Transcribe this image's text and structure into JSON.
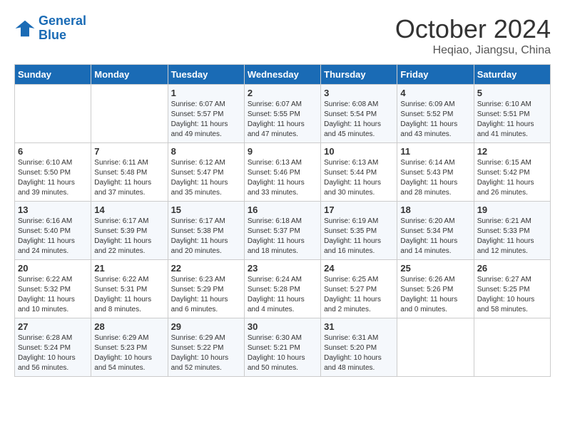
{
  "logo": {
    "line1": "General",
    "line2": "Blue"
  },
  "title": "October 2024",
  "subtitle": "Heqiao, Jiangsu, China",
  "weekdays": [
    "Sunday",
    "Monday",
    "Tuesday",
    "Wednesday",
    "Thursday",
    "Friday",
    "Saturday"
  ],
  "weeks": [
    [
      {
        "day": "",
        "info": ""
      },
      {
        "day": "",
        "info": ""
      },
      {
        "day": "1",
        "info": "Sunrise: 6:07 AM\nSunset: 5:57 PM\nDaylight: 11 hours and 49 minutes."
      },
      {
        "day": "2",
        "info": "Sunrise: 6:07 AM\nSunset: 5:55 PM\nDaylight: 11 hours and 47 minutes."
      },
      {
        "day": "3",
        "info": "Sunrise: 6:08 AM\nSunset: 5:54 PM\nDaylight: 11 hours and 45 minutes."
      },
      {
        "day": "4",
        "info": "Sunrise: 6:09 AM\nSunset: 5:52 PM\nDaylight: 11 hours and 43 minutes."
      },
      {
        "day": "5",
        "info": "Sunrise: 6:10 AM\nSunset: 5:51 PM\nDaylight: 11 hours and 41 minutes."
      }
    ],
    [
      {
        "day": "6",
        "info": "Sunrise: 6:10 AM\nSunset: 5:50 PM\nDaylight: 11 hours and 39 minutes."
      },
      {
        "day": "7",
        "info": "Sunrise: 6:11 AM\nSunset: 5:48 PM\nDaylight: 11 hours and 37 minutes."
      },
      {
        "day": "8",
        "info": "Sunrise: 6:12 AM\nSunset: 5:47 PM\nDaylight: 11 hours and 35 minutes."
      },
      {
        "day": "9",
        "info": "Sunrise: 6:13 AM\nSunset: 5:46 PM\nDaylight: 11 hours and 33 minutes."
      },
      {
        "day": "10",
        "info": "Sunrise: 6:13 AM\nSunset: 5:44 PM\nDaylight: 11 hours and 30 minutes."
      },
      {
        "day": "11",
        "info": "Sunrise: 6:14 AM\nSunset: 5:43 PM\nDaylight: 11 hours and 28 minutes."
      },
      {
        "day": "12",
        "info": "Sunrise: 6:15 AM\nSunset: 5:42 PM\nDaylight: 11 hours and 26 minutes."
      }
    ],
    [
      {
        "day": "13",
        "info": "Sunrise: 6:16 AM\nSunset: 5:40 PM\nDaylight: 11 hours and 24 minutes."
      },
      {
        "day": "14",
        "info": "Sunrise: 6:17 AM\nSunset: 5:39 PM\nDaylight: 11 hours and 22 minutes."
      },
      {
        "day": "15",
        "info": "Sunrise: 6:17 AM\nSunset: 5:38 PM\nDaylight: 11 hours and 20 minutes."
      },
      {
        "day": "16",
        "info": "Sunrise: 6:18 AM\nSunset: 5:37 PM\nDaylight: 11 hours and 18 minutes."
      },
      {
        "day": "17",
        "info": "Sunrise: 6:19 AM\nSunset: 5:35 PM\nDaylight: 11 hours and 16 minutes."
      },
      {
        "day": "18",
        "info": "Sunrise: 6:20 AM\nSunset: 5:34 PM\nDaylight: 11 hours and 14 minutes."
      },
      {
        "day": "19",
        "info": "Sunrise: 6:21 AM\nSunset: 5:33 PM\nDaylight: 11 hours and 12 minutes."
      }
    ],
    [
      {
        "day": "20",
        "info": "Sunrise: 6:22 AM\nSunset: 5:32 PM\nDaylight: 11 hours and 10 minutes."
      },
      {
        "day": "21",
        "info": "Sunrise: 6:22 AM\nSunset: 5:31 PM\nDaylight: 11 hours and 8 minutes."
      },
      {
        "day": "22",
        "info": "Sunrise: 6:23 AM\nSunset: 5:29 PM\nDaylight: 11 hours and 6 minutes."
      },
      {
        "day": "23",
        "info": "Sunrise: 6:24 AM\nSunset: 5:28 PM\nDaylight: 11 hours and 4 minutes."
      },
      {
        "day": "24",
        "info": "Sunrise: 6:25 AM\nSunset: 5:27 PM\nDaylight: 11 hours and 2 minutes."
      },
      {
        "day": "25",
        "info": "Sunrise: 6:26 AM\nSunset: 5:26 PM\nDaylight: 11 hours and 0 minutes."
      },
      {
        "day": "26",
        "info": "Sunrise: 6:27 AM\nSunset: 5:25 PM\nDaylight: 10 hours and 58 minutes."
      }
    ],
    [
      {
        "day": "27",
        "info": "Sunrise: 6:28 AM\nSunset: 5:24 PM\nDaylight: 10 hours and 56 minutes."
      },
      {
        "day": "28",
        "info": "Sunrise: 6:29 AM\nSunset: 5:23 PM\nDaylight: 10 hours and 54 minutes."
      },
      {
        "day": "29",
        "info": "Sunrise: 6:29 AM\nSunset: 5:22 PM\nDaylight: 10 hours and 52 minutes."
      },
      {
        "day": "30",
        "info": "Sunrise: 6:30 AM\nSunset: 5:21 PM\nDaylight: 10 hours and 50 minutes."
      },
      {
        "day": "31",
        "info": "Sunrise: 6:31 AM\nSunset: 5:20 PM\nDaylight: 10 hours and 48 minutes."
      },
      {
        "day": "",
        "info": ""
      },
      {
        "day": "",
        "info": ""
      }
    ]
  ]
}
